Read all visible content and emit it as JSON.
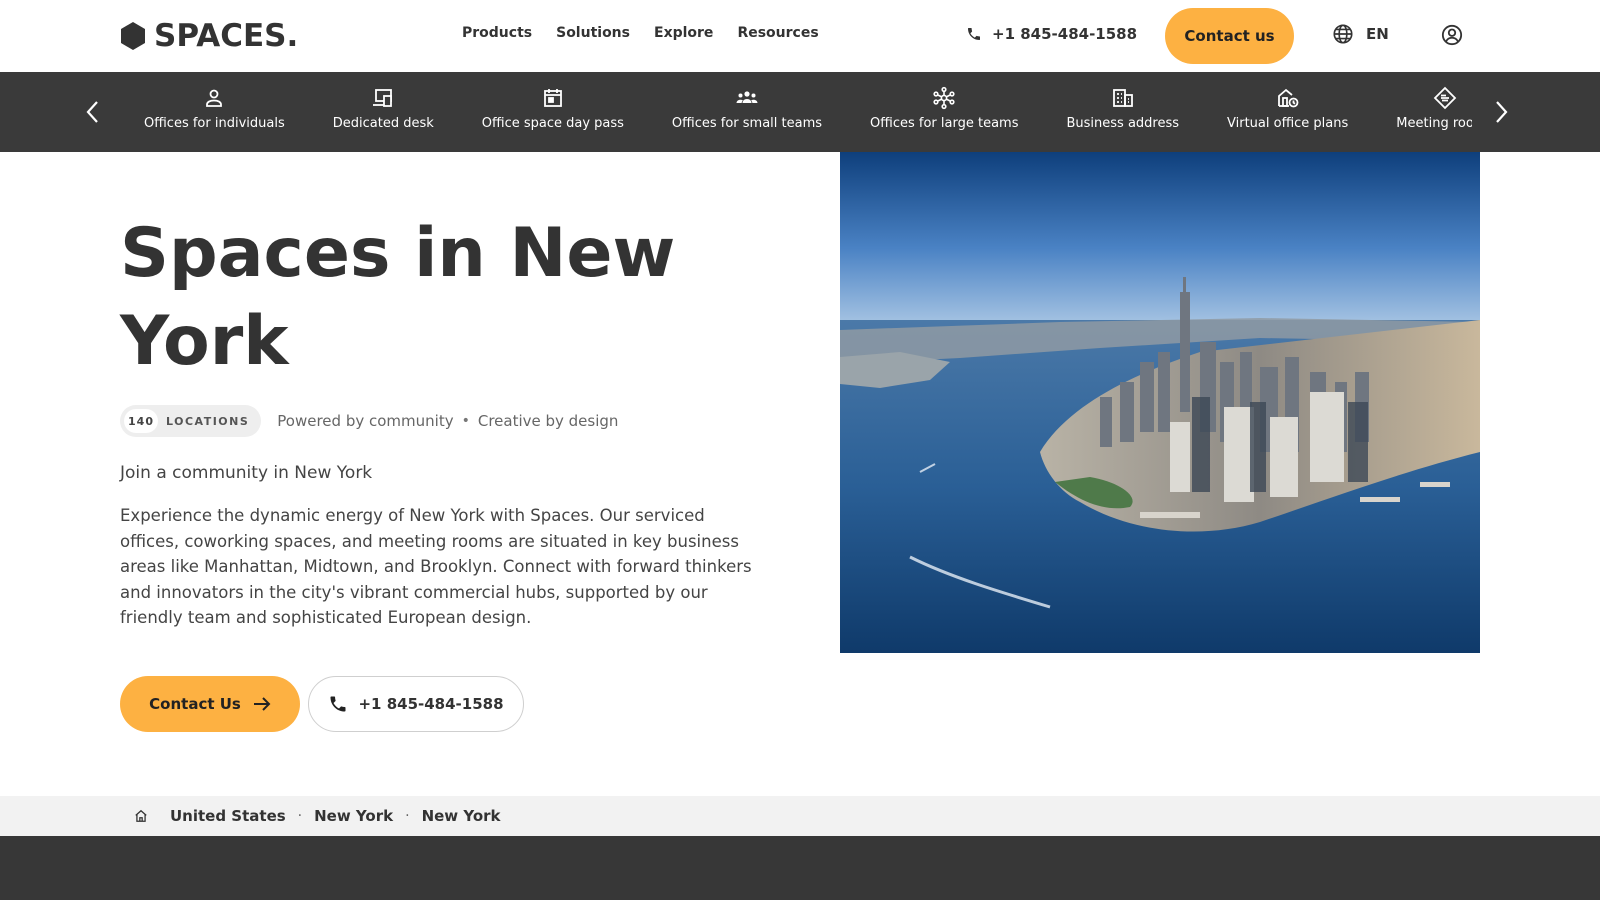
{
  "header": {
    "logo_text": "SPACES.",
    "nav": [
      {
        "label": "Products"
      },
      {
        "label": "Solutions"
      },
      {
        "label": "Explore"
      },
      {
        "label": "Resources"
      }
    ],
    "phone": "+1 845-484-1588",
    "contact_label": "Contact us",
    "language": "EN"
  },
  "categories": {
    "items": [
      {
        "label": "Offices for individuals",
        "icon": "person-icon"
      },
      {
        "label": "Dedicated desk",
        "icon": "desk-icon"
      },
      {
        "label": "Office space day pass",
        "icon": "calendar-icon"
      },
      {
        "label": "Offices for small teams",
        "icon": "team-icon"
      },
      {
        "label": "Offices for large teams",
        "icon": "network-icon"
      },
      {
        "label": "Business address",
        "icon": "building-icon"
      },
      {
        "label": "Virtual office plans",
        "icon": "virtual-office-icon"
      },
      {
        "label": "Meeting rooms",
        "icon": "meeting-room-icon"
      }
    ]
  },
  "hero": {
    "title": "Spaces in New York",
    "locations_count": "140",
    "locations_label": "LOCATIONS",
    "tagline_1": "Powered by community",
    "tagline_sep": "•",
    "tagline_2": "Creative by design",
    "subtitle": "Join a community in New York",
    "body": "Experience the dynamic energy of New York with Spaces. Our serviced offices, coworking spaces, and meeting rooms are situated in key business areas like Manhattan, Midtown, and Brooklyn. Connect with forward thinkers and innovators in the city's vibrant commercial hubs, supported by our friendly team and sophisticated European design.",
    "cta_contact": "Contact Us",
    "cta_phone": "+1 845-484-1588"
  },
  "breadcrumb": {
    "items": [
      "United States",
      "New York",
      "New York"
    ],
    "separator": "·"
  },
  "colors": {
    "accent": "#fdb142",
    "dark_bar": "#3a3a3a",
    "text": "#333333"
  }
}
